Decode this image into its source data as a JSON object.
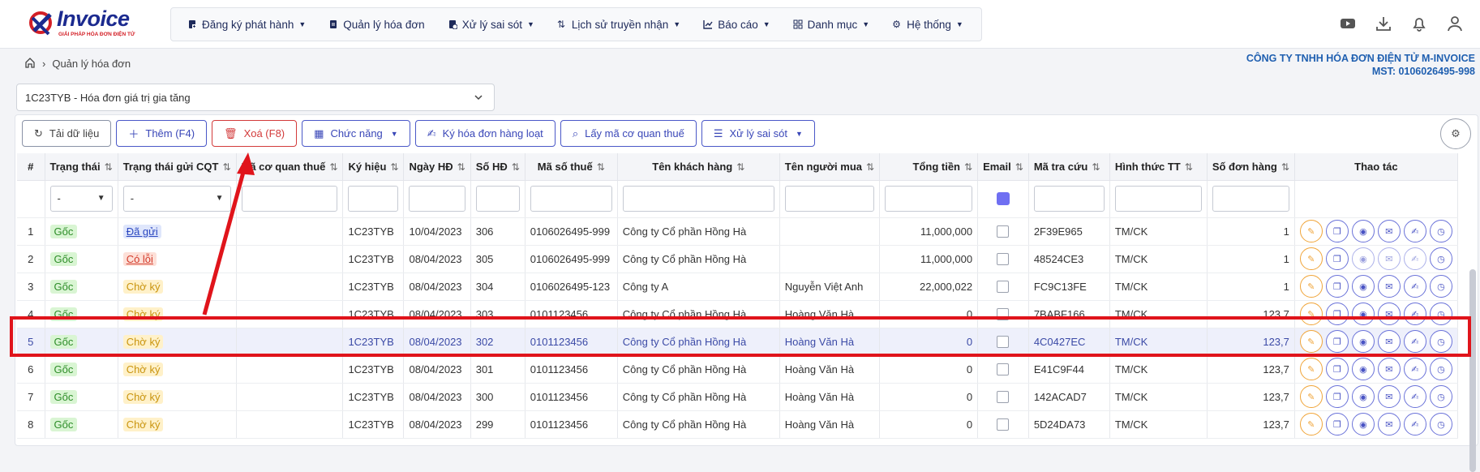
{
  "logo": {
    "brand": "Invoice",
    "slogan": "GIẢI PHÁP HÓA ĐƠN ĐIỆN TỬ"
  },
  "nav": [
    {
      "label": "Đăng ký phát hành",
      "icon": "file-register-icon",
      "dropdown": true
    },
    {
      "label": "Quản lý hóa đơn",
      "icon": "file-icon",
      "dropdown": false
    },
    {
      "label": "Xử lý sai sót",
      "icon": "file-error-icon",
      "dropdown": true
    },
    {
      "label": "Lịch sử truyền nhận",
      "icon": "transfer-icon",
      "dropdown": true
    },
    {
      "label": "Báo cáo",
      "icon": "chart-icon",
      "dropdown": true
    },
    {
      "label": "Danh mục",
      "icon": "grid-icon",
      "dropdown": true
    },
    {
      "label": "Hệ thống",
      "icon": "gear-icon",
      "dropdown": true
    }
  ],
  "breadcrumb": {
    "current": "Quản lý hóa đơn"
  },
  "company": {
    "name": "CÔNG TY TNHH HÓA ĐƠN ĐIỆN TỬ M-INVOICE",
    "tax": "MST: 0106026495-998"
  },
  "series_select": {
    "value": "1C23TYB - Hóa đơn giá trị gia tăng"
  },
  "toolbar": {
    "reload": "Tải dữ liệu",
    "add": "Thêm (F4)",
    "delete": "Xoá (F8)",
    "functions": "Chức năng",
    "batch_sign": "Ký hóa đơn hàng loạt",
    "get_code": "Lấy mã cơ quan thuế",
    "handle_error": "Xử lý sai sót"
  },
  "columns": [
    "#",
    "Trạng thái",
    "Trạng thái gửi CQT",
    "Mã cơ quan thuế",
    "Ký hiệu",
    "Ngày HĐ",
    "Số HĐ",
    "Mã số thuế",
    "Tên khách hàng",
    "Tên người mua",
    "Tổng tiền",
    "Email",
    "Mã tra cứu",
    "Hình thức TT",
    "Số đơn hàng",
    "Thao tác"
  ],
  "filter": {
    "status": "-",
    "cqt_status": "-"
  },
  "rows": [
    {
      "no": "1",
      "status": "Gốc",
      "cqt": "Đã gửi",
      "cqt_type": "dagui",
      "code": "",
      "symbol": "1C23TYB",
      "date": "10/04/2023",
      "num": "306",
      "tax": "0106026495-999",
      "customer": "Công ty Cổ phần Hồng Hà",
      "buyer": "",
      "total": "11,000,000",
      "lookup": "2F39E965",
      "pay": "TM/CK",
      "order": "1"
    },
    {
      "no": "2",
      "status": "Gốc",
      "cqt": "Có lỗi",
      "cqt_type": "coloi",
      "code": "",
      "symbol": "1C23TYB",
      "date": "08/04/2023",
      "num": "305",
      "tax": "0106026495-999",
      "customer": "Công ty Cổ phần Hồng Hà",
      "buyer": "",
      "total": "11,000,000",
      "lookup": "48524CE3",
      "pay": "TM/CK",
      "order": "1"
    },
    {
      "no": "3",
      "status": "Gốc",
      "cqt": "Chờ ký",
      "cqt_type": "choky",
      "code": "",
      "symbol": "1C23TYB",
      "date": "08/04/2023",
      "num": "304",
      "tax": "0106026495-123",
      "customer": "Công ty A",
      "buyer": "Nguyễn Việt Anh",
      "total": "22,000,022",
      "lookup": "FC9C13FE",
      "pay": "TM/CK",
      "order": "1"
    },
    {
      "no": "4",
      "status": "Gốc",
      "cqt": "Chờ ký",
      "cqt_type": "choky",
      "code": "",
      "symbol": "1C23TYB",
      "date": "08/04/2023",
      "num": "303",
      "tax": "0101123456",
      "customer": "Công ty Cổ phần Hồng Hà",
      "buyer": "Hoàng Văn Hà",
      "total": "0",
      "lookup": "7BABF166",
      "pay": "TM/CK",
      "order": "123,7"
    },
    {
      "no": "5",
      "status": "Gốc",
      "cqt": "Chờ ký",
      "cqt_type": "choky",
      "code": "",
      "symbol": "1C23TYB",
      "date": "08/04/2023",
      "num": "302",
      "tax": "0101123456",
      "customer": "Công ty Cổ phần Hồng Hà",
      "buyer": "Hoàng Văn Hà",
      "total": "0",
      "lookup": "4C0427EC",
      "pay": "TM/CK",
      "order": "123,7"
    },
    {
      "no": "6",
      "status": "Gốc",
      "cqt": "Chờ ký",
      "cqt_type": "choky",
      "code": "",
      "symbol": "1C23TYB",
      "date": "08/04/2023",
      "num": "301",
      "tax": "0101123456",
      "customer": "Công ty Cổ phần Hồng Hà",
      "buyer": "Hoàng Văn Hà",
      "total": "0",
      "lookup": "E41C9F44",
      "pay": "TM/CK",
      "order": "123,7"
    },
    {
      "no": "7",
      "status": "Gốc",
      "cqt": "Chờ ký",
      "cqt_type": "choky",
      "code": "",
      "symbol": "1C23TYB",
      "date": "08/04/2023",
      "num": "300",
      "tax": "0101123456",
      "customer": "Công ty Cổ phần Hồng Hà",
      "buyer": "Hoàng Văn Hà",
      "total": "0",
      "lookup": "142ACAD7",
      "pay": "TM/CK",
      "order": "123,7"
    },
    {
      "no": "8",
      "status": "Gốc",
      "cqt": "Chờ ký",
      "cqt_type": "choky",
      "code": "",
      "symbol": "1C23TYB",
      "date": "08/04/2023",
      "num": "299",
      "tax": "0101123456",
      "customer": "Công ty Cổ phần Hồng Hà",
      "buyer": "Hoàng Văn Hà",
      "total": "0",
      "lookup": "5D24DA73",
      "pay": "TM/CK",
      "order": "123,7"
    }
  ],
  "selected_row": 4,
  "colors": {
    "accent": "#4a58c8",
    "highlight": "#e0141b"
  }
}
